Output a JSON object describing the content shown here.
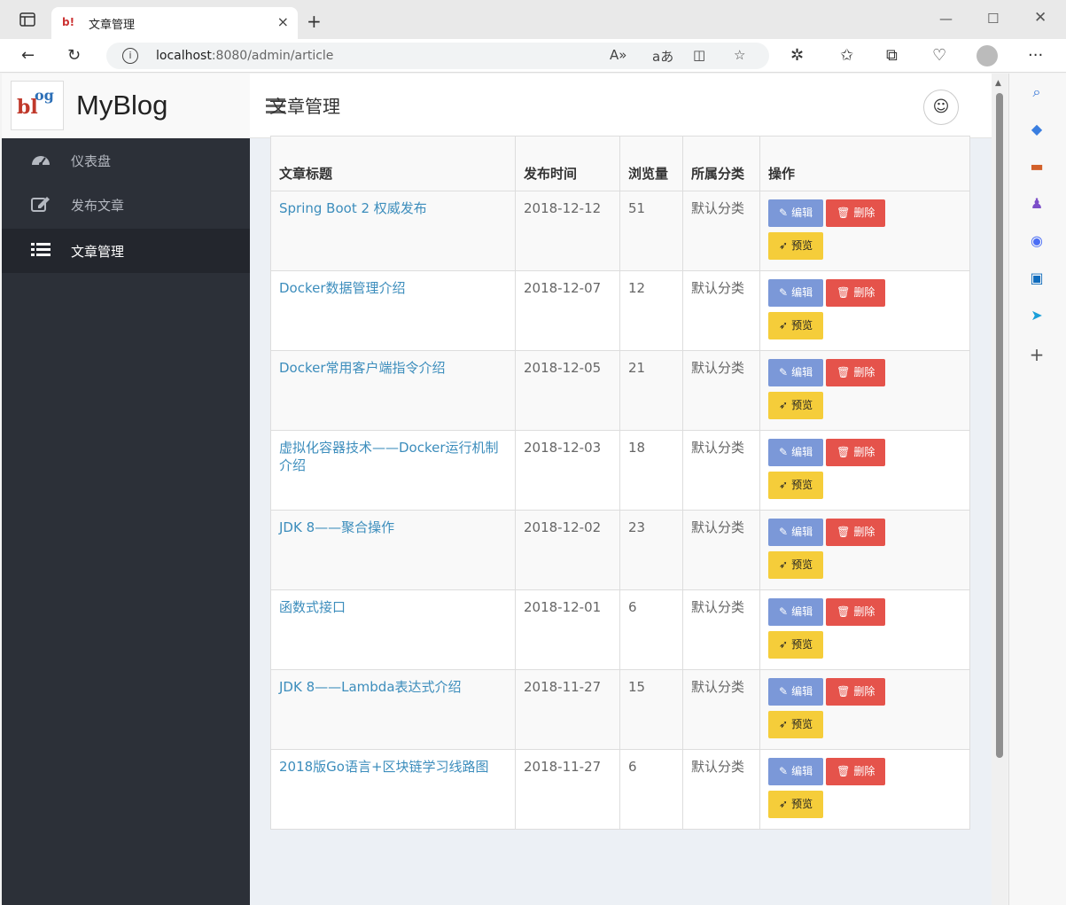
{
  "browser": {
    "tab_title": "文章管理",
    "address_host": "localhost",
    "address_rest": ":8080/admin/article"
  },
  "app": {
    "brand_name": "MyBlog",
    "logo_text_a": "bl",
    "logo_text_b": "og"
  },
  "sidebar": {
    "items": [
      {
        "label": "仪表盘",
        "icon": "dashboard-icon",
        "active": false
      },
      {
        "label": "发布文章",
        "icon": "edit-icon",
        "active": false
      },
      {
        "label": "文章管理",
        "icon": "list-icon",
        "active": true
      }
    ]
  },
  "page": {
    "title": "文章管理",
    "columns": [
      "文章标题",
      "发布时间",
      "浏览量",
      "所属分类",
      "操作"
    ],
    "actions": {
      "edit": "编辑",
      "delete": "删除",
      "preview": "预览"
    },
    "rows": [
      {
        "title": "Spring Boot 2 权威发布",
        "date": "2018-12-12",
        "views": "51",
        "category": "默认分类"
      },
      {
        "title": "Docker数据管理介绍",
        "date": "2018-12-07",
        "views": "12",
        "category": "默认分类"
      },
      {
        "title": "Docker常用客户端指令介绍",
        "date": "2018-12-05",
        "views": "21",
        "category": "默认分类"
      },
      {
        "title": "虚拟化容器技术——Docker运行机制介绍",
        "date": "2018-12-03",
        "views": "18",
        "category": "默认分类"
      },
      {
        "title": "JDK 8——聚合操作",
        "date": "2018-12-02",
        "views": "23",
        "category": "默认分类"
      },
      {
        "title": "函数式接口",
        "date": "2018-12-01",
        "views": "6",
        "category": "默认分类"
      },
      {
        "title": "JDK 8——Lambda表达式介绍",
        "date": "2018-11-27",
        "views": "15",
        "category": "默认分类"
      },
      {
        "title": "2018版Go语言+区块链学习线路图",
        "date": "2018-11-27",
        "views": "6",
        "category": "默认分类"
      }
    ]
  },
  "colors": {
    "sidebar_bg": "#2c3038",
    "link": "#3c8dbc",
    "edit_btn": "#7b98d8",
    "delete_btn": "#e5534b",
    "preview_btn": "#f5cd3a"
  }
}
